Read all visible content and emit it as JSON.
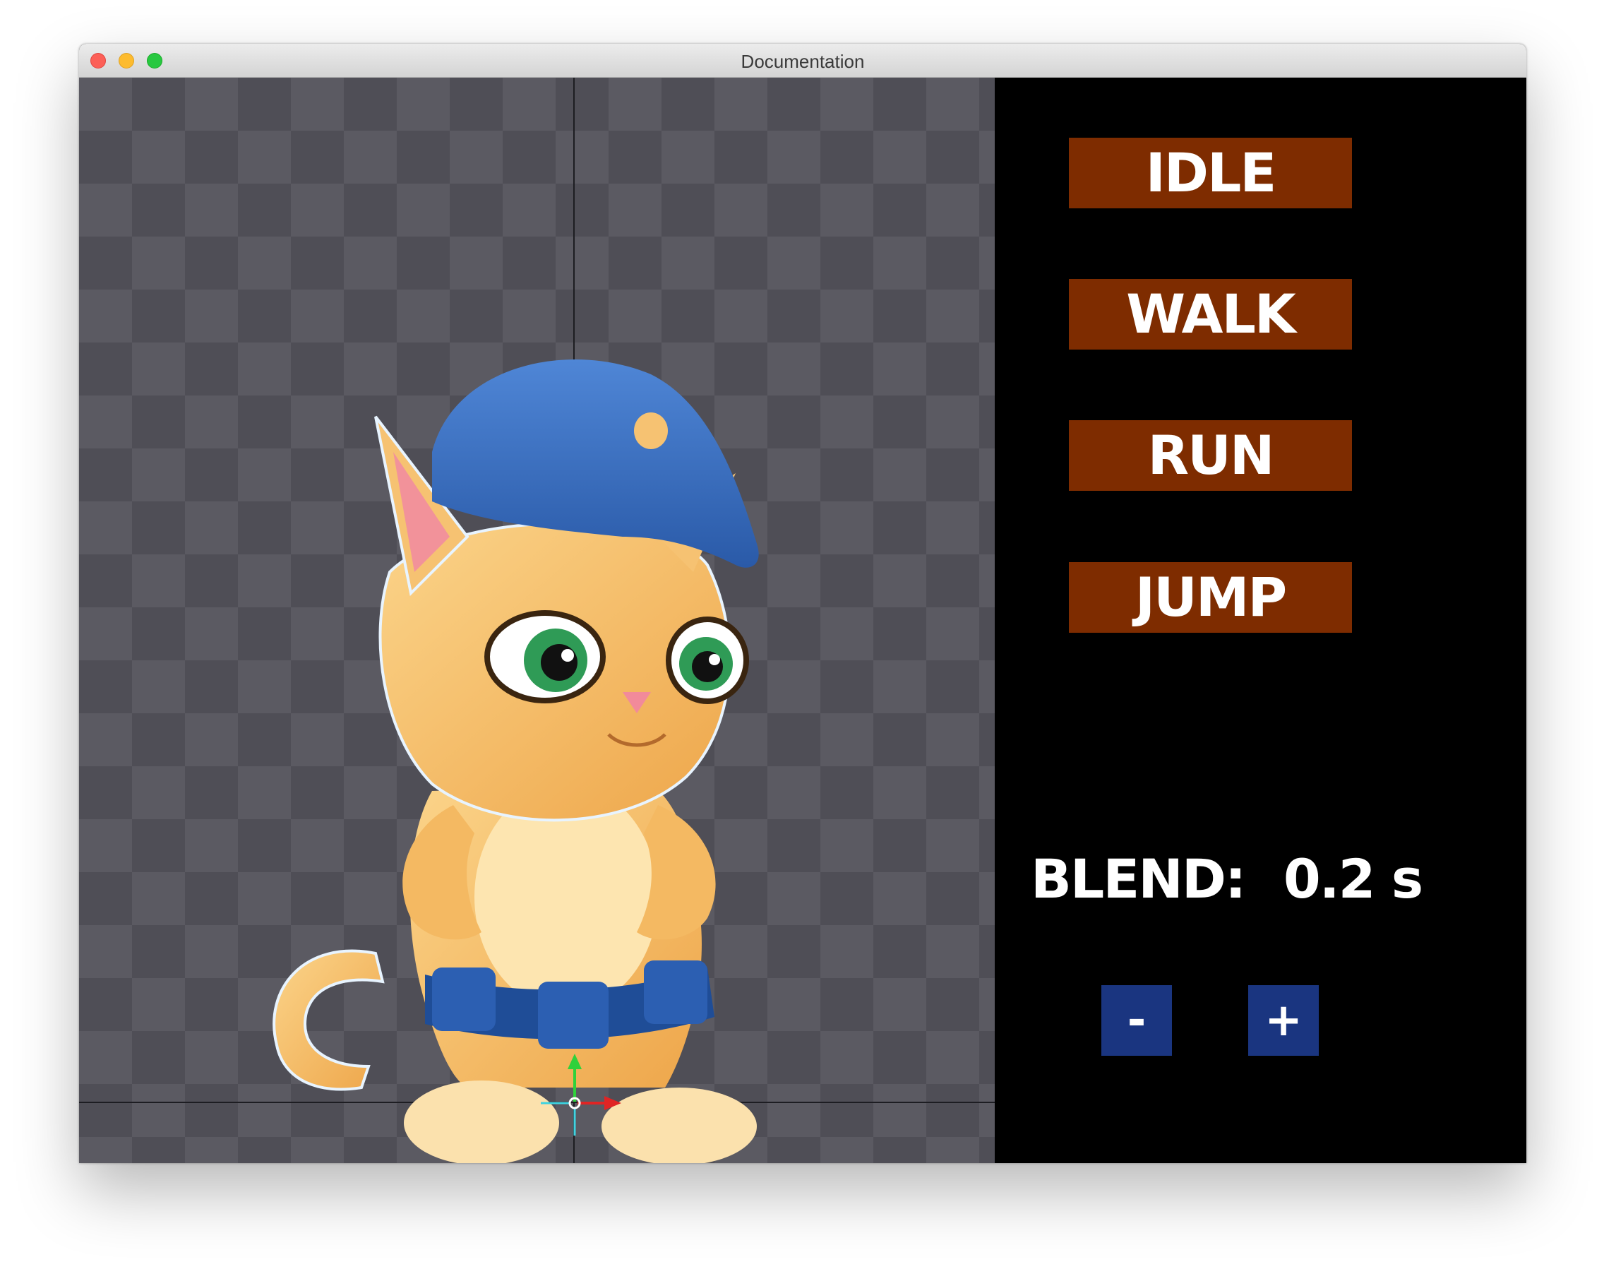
{
  "window": {
    "title": "Documentation"
  },
  "scene": {
    "icons": [
      "cat-character",
      "transform-gizmo-icon"
    ]
  },
  "animations": [
    {
      "label": "IDLE"
    },
    {
      "label": "WALK"
    },
    {
      "label": "RUN"
    },
    {
      "label": "JUMP"
    }
  ],
  "blend": {
    "label": "BLEND:",
    "value": "0.2 s"
  },
  "controls": {
    "decrease_label": "-",
    "increase_label": "+"
  },
  "colors": {
    "button_bg": "#7e2c00",
    "stepper_bg": "#1a3580",
    "panel_bg": "#000000"
  }
}
